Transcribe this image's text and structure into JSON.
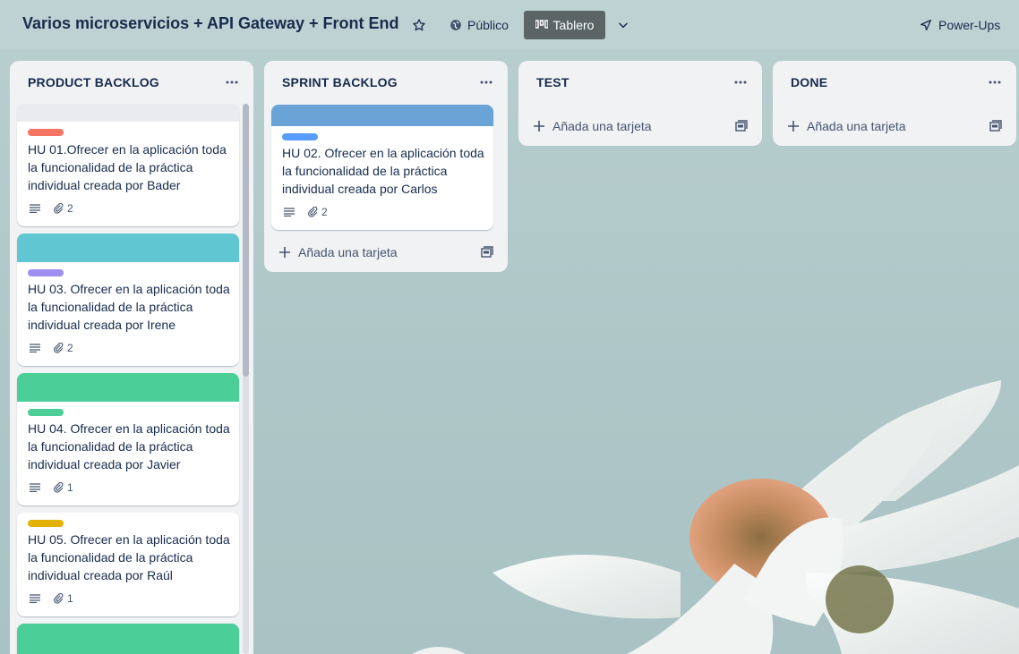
{
  "board": {
    "title": "Varios microservicios + API Gateway + Front End",
    "visibility_label": "Público",
    "view_label": "Tablero",
    "powerups_label": "Power-Ups"
  },
  "lists": [
    {
      "title": "PRODUCT BACKLOG",
      "cards": [
        {
          "text_lines": [
            "HU 01.Ofrecer en la aplicación toda",
            "la funcionalidad de la práctica",
            "individual creada por Bader"
          ],
          "label_color": "#f87462",
          "cover_color": "",
          "attachments": "2"
        },
        {
          "text_lines": [
            "HU 03. Ofrecer en la aplicación toda",
            "la funcionalidad de la práctica",
            "individual creada por Irene"
          ],
          "label_color": "#9f8fef",
          "cover_color": "#60c6d2",
          "attachments": "2"
        },
        {
          "text_lines": [
            "HU 04. Ofrecer en la aplicación toda",
            "la funcionalidad de la práctica",
            "individual creada por Javier"
          ],
          "label_color": "#4bce97",
          "cover_color": "#4bce97",
          "attachments": "1"
        },
        {
          "text_lines": [
            "HU 05. Ofrecer en la aplicación toda",
            "la funcionalidad de la práctica",
            "individual creada por Raúl"
          ],
          "label_color": "#e2b203",
          "cover_color": "",
          "attachments": "1"
        }
      ]
    },
    {
      "title": "SPRINT BACKLOG",
      "cards": [
        {
          "text_lines": [
            "HU 02. Ofrecer en la aplicación toda",
            "la funcionalidad de la práctica",
            "individual creada por Carlos"
          ],
          "label_color": "#579dff",
          "cover_color": "#6aa3d5",
          "attachments": "2"
        }
      ],
      "add_card_label": "Añada una tarjeta"
    },
    {
      "title": "TEST",
      "cards": [],
      "add_card_label": "Añada una tarjeta"
    },
    {
      "title": "DONE",
      "cards": [],
      "add_card_label": "Añada una tarjeta"
    }
  ],
  "colors": {
    "header_bg": "#bed2d4",
    "list_bg": "#f1f2f4",
    "active_view_bg": "#5b6566"
  },
  "icons": [
    "star-icon",
    "globe-icon",
    "board-icon",
    "chevron-down-icon",
    "rocket-icon",
    "more-icon",
    "description-icon",
    "attachment-icon",
    "plus-icon",
    "template-icon"
  ]
}
